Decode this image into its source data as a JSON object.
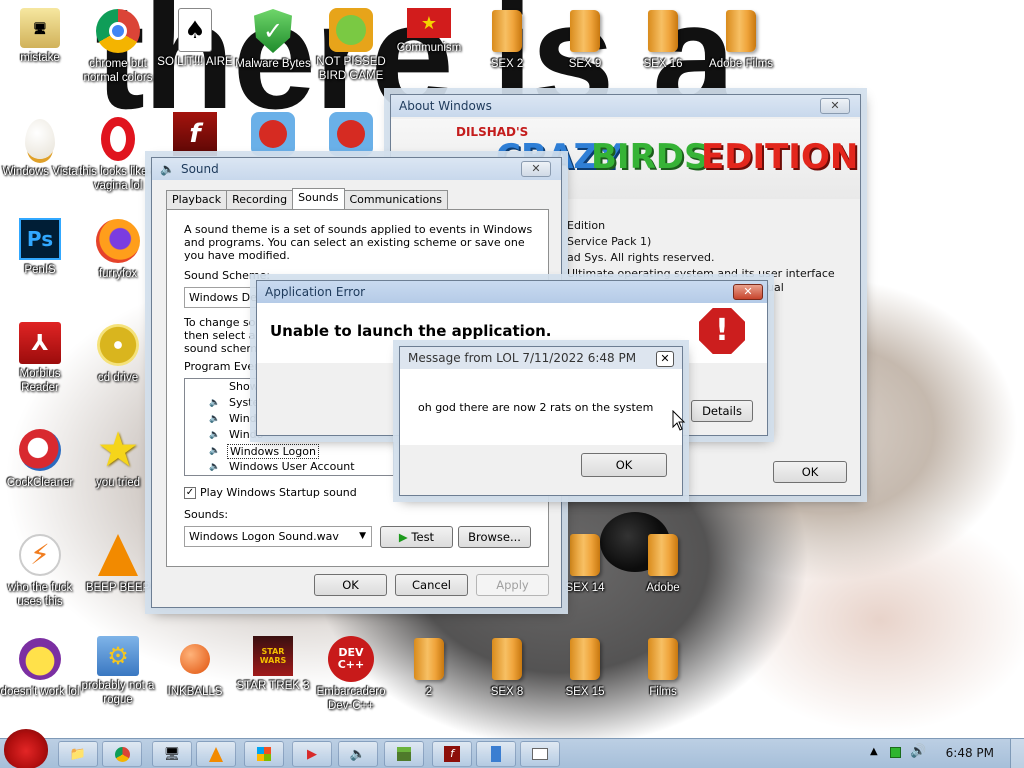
{
  "wallpaper": {
    "text": "there is a"
  },
  "desktop": {
    "icons_col1": [
      "mistake",
      "Windows Vista",
      "PenIS",
      "Morbius Reader",
      "CockCleaner",
      "who the fuck uses this",
      "doesn't work lol"
    ],
    "icons_col2": [
      "chrome but normal colors",
      "this looks like a vagina lol",
      "furryfox",
      "cd drive",
      "you tried",
      "BEEP BEEP",
      "probably not a rogue"
    ],
    "icons_top": [
      "SO LIT!!! AIRE",
      "Malware Bytes",
      "NOT PISSED BIRD GAME",
      "Communism",
      "SEX 2",
      "SEX 9",
      "SEX 16",
      "Adobe Films"
    ],
    "icons_bottom": [
      "INKBALLS",
      "STAR TREK 3",
      "Embarcadero Dev-C++",
      "2",
      "SEX 8",
      "SEX 15",
      "Films"
    ],
    "icons_mid": [
      "SEX 14",
      "Adobe"
    ],
    "icon_glyph_texts": {
      "ps": "Ps",
      "devcpp": "DEV C++"
    }
  },
  "sound": {
    "title": "Sound",
    "tabs": [
      "Playback",
      "Recording",
      "Sounds",
      "Communications"
    ],
    "description": "A sound theme is a set of sounds applied to events in Windows and programs.  You can select an existing scheme or save one you have modified.",
    "scheme_label": "Sound Scheme:",
    "scheme_value": "Windows De",
    "change_text": [
      "To change sou",
      "then select a s",
      "sound schem"
    ],
    "program_events_label": "Program Even",
    "events": [
      "Show",
      "Syste",
      "Windo",
      "Windo",
      "Windows Logon",
      "Windows User Account Control"
    ],
    "play_startup_label": "Play Windows Startup sound",
    "sounds_label": "Sounds:",
    "sound_file": "Windows Logon Sound.wav",
    "test_label": "Test",
    "browse_label": "Browse...",
    "ok_label": "OK",
    "cancel_label": "Cancel",
    "apply_label": "Apply"
  },
  "about": {
    "title": "About Windows",
    "banner_brand": "DILSHAD'S",
    "banner_word1": "CRAZY",
    "banner_word2": "BIRDS",
    "banner_word3": "EDITION",
    "lines": [
      "Edition",
      "Service Pack 1)",
      "ad Sys.  All rights reserved.",
      "Ultimate operating system and its user interface",
      "ual"
    ],
    "ok_label": "OK"
  },
  "app_error": {
    "title": "Application Error",
    "message": "Unable to launch the application.",
    "details_label": "Details"
  },
  "message_box": {
    "title": "Message from LOL 7/11/2022 6:48 PM",
    "text": "oh god there are now 2 rats on the system",
    "ok_label": "OK"
  },
  "taskbar": {
    "clock": "6:48 PM"
  },
  "colors": {
    "accent": "#1e3a5b",
    "error_red": "#cc1e1e",
    "taskbar": "#bccfe4"
  }
}
